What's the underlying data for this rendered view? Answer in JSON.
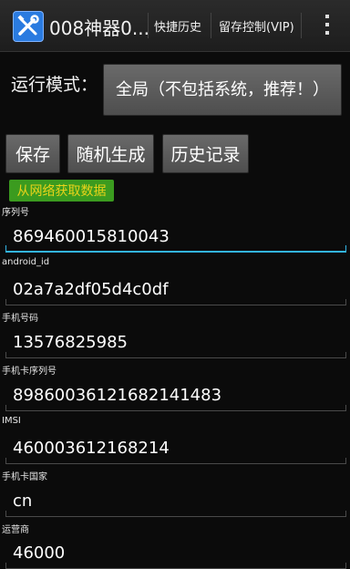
{
  "action_bar": {
    "title": "008神器0...",
    "action_history": "快捷历史",
    "action_control": "留存控制(VIP)",
    "overflow_icon": "overflow-menu-icon",
    "app_icon": "wrench-screwdriver-icon"
  },
  "mode": {
    "label": "运行模式：",
    "value": "全局（不包括系统，推荐！）"
  },
  "buttons": {
    "save": "保存",
    "random": "随机生成",
    "history": "历史记录",
    "fetch_network": "从网络获取数据"
  },
  "fields": [
    {
      "label": "序列号",
      "value": "869460015810043"
    },
    {
      "label": "android_id",
      "value": "02a7a2df05d4c0df"
    },
    {
      "label": "手机号码",
      "value": "13576825985"
    },
    {
      "label": "手机卡序列号",
      "value": "89860036121682141483"
    },
    {
      "label": "IMSI",
      "value": "460003612168214"
    },
    {
      "label": "手机卡国家",
      "value": "cn"
    },
    {
      "label": "运营商",
      "value": "46000"
    }
  ],
  "colors": {
    "accent": "#33b5e5",
    "fetch_button_bg": "#3b9b1f",
    "fetch_button_text": "#e8d31a"
  }
}
